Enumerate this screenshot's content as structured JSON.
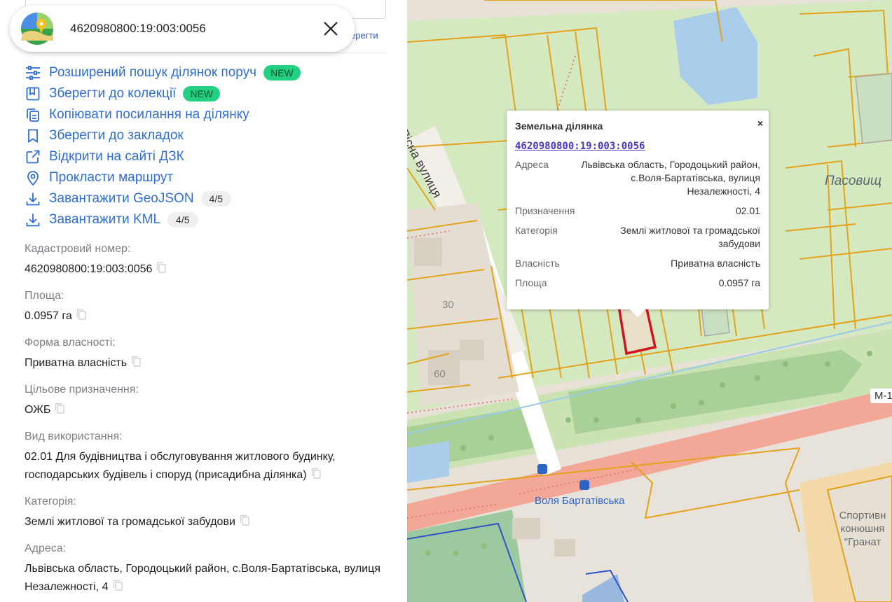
{
  "search": {
    "query": "4620980800:19:003:0056",
    "edge_link_text": "ерегти"
  },
  "actions": [
    {
      "label": "Розширений пошук ділянок поруч",
      "badge": "NEW",
      "icon": "sliders-icon"
    },
    {
      "label": "Зберегти до колекції",
      "badge": "NEW",
      "icon": "bookmark-square-icon"
    },
    {
      "label": "Копіювати посилання на ділянку",
      "icon": "copy-link-icon"
    },
    {
      "label": "Зберегти до закладок",
      "icon": "bookmark-icon"
    },
    {
      "label": "Відкрити на сайті ДЗК",
      "icon": "external-link-icon"
    },
    {
      "label": "Прокласти маршрут",
      "icon": "map-pin-icon"
    },
    {
      "label": "Завантажити GeoJSON",
      "count": "4/5",
      "icon": "download-icon"
    },
    {
      "label": "Завантажити KML",
      "count": "4/5",
      "icon": "download-icon"
    }
  ],
  "details": [
    {
      "label": "Кадастровий номер:",
      "value": "4620980800:19:003:0056"
    },
    {
      "label": "Площа:",
      "value": "0.0957 га"
    },
    {
      "label": "Форма власності:",
      "value": "Приватна власність"
    },
    {
      "label": "Цільове призначення:",
      "value": "ОЖБ"
    },
    {
      "label": "Вид використання:",
      "value": "02.01 Для будівництва і обслуговування житлового будинку, господарських будівель і споруд (присадибна ділянка)"
    },
    {
      "label": "Категорія:",
      "value": "Землі житлової та громадської забудови"
    },
    {
      "label": "Адреса:",
      "value": "Львівська область, Городоцький район, с.Воля-Бартатівська, вулиця Незалежності, 4"
    }
  ],
  "popup": {
    "title": "Земельна ділянка",
    "close": "×",
    "cadastral": "4620980800:19:003:0056",
    "rows": [
      {
        "key": "Адреса",
        "value": "Львівська область, Городоцький район, с.Воля-Бартатівська, вулиця Незалежності, 4"
      },
      {
        "key": "Призначення",
        "value": "02.01"
      },
      {
        "key": "Категорія",
        "value": "Землі житлової та громадської забудови"
      },
      {
        "key": "Власність",
        "value": "Приватна власність"
      },
      {
        "key": "Площа",
        "value": "0.0957 га"
      }
    ]
  },
  "map": {
    "street": "Пісна вулиця",
    "place": "Пасовищ",
    "stop": "Воля Бартатівська",
    "poi": "Спортивн конюшня \"Гранат",
    "road_ref": "М-1",
    "house_30": "30",
    "house_60": "60",
    "colors": {
      "parcel_outline": "#e3a21a",
      "selected_parcel": "#d0141c",
      "green": "#cfe6b8",
      "highway": "#f1a596",
      "link": "#2f6ed8"
    }
  }
}
